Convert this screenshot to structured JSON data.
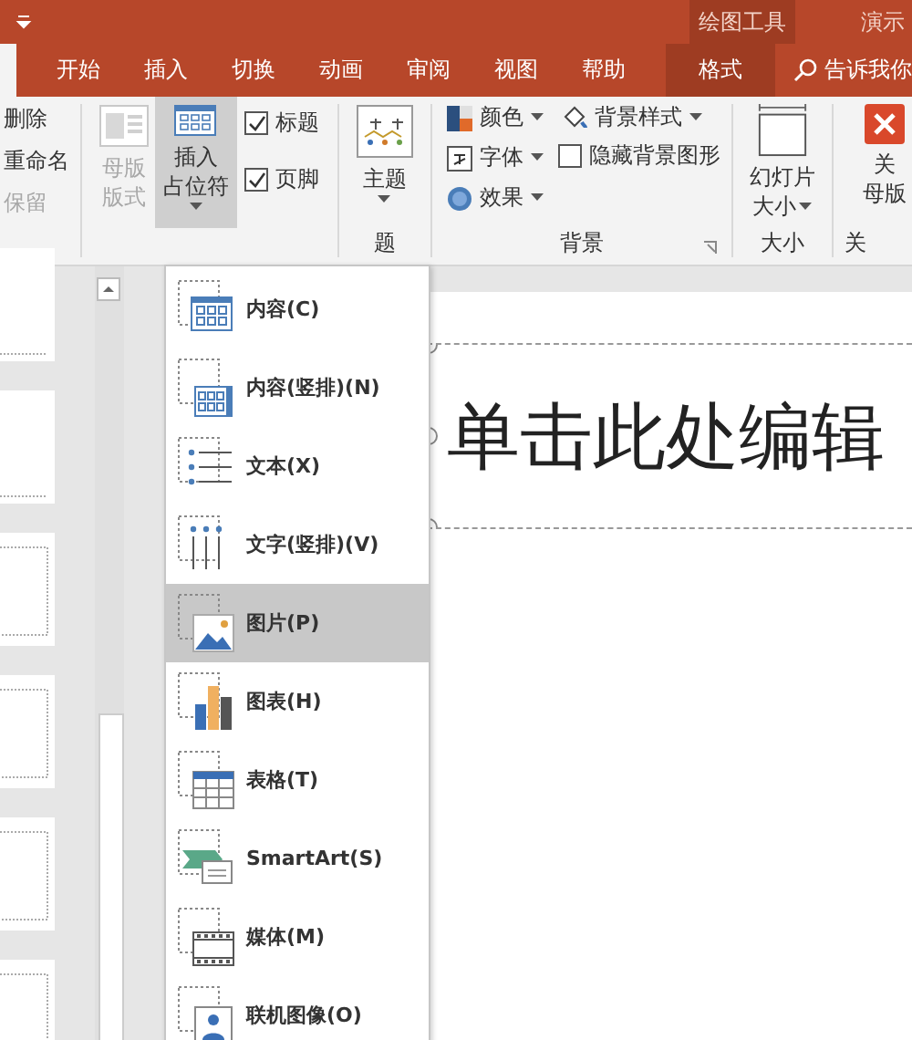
{
  "title_bar": {
    "tool_group": "绘图工具",
    "document_title": "演示"
  },
  "tabs": [
    {
      "label": "开始",
      "contextual": false
    },
    {
      "label": "插入",
      "contextual": false
    },
    {
      "label": "切换",
      "contextual": false
    },
    {
      "label": "动画",
      "contextual": false
    },
    {
      "label": "审阅",
      "contextual": false
    },
    {
      "label": "视图",
      "contextual": false
    },
    {
      "label": "帮助",
      "contextual": false
    },
    {
      "label": "格式",
      "contextual": true
    }
  ],
  "tell_me": "告诉我你",
  "ribbon": {
    "edit_commands": [
      {
        "label": "删除",
        "disabled": false
      },
      {
        "label": "重命名",
        "disabled": false
      },
      {
        "label": "保留",
        "disabled": true
      }
    ],
    "master_layout": {
      "lines": [
        "母版",
        "版式"
      ],
      "disabled": true
    },
    "insert_placeholder": {
      "lines": [
        "插入",
        "占位符"
      ],
      "expanded": true
    },
    "checkboxes": [
      {
        "label": "标题",
        "checked": true
      },
      {
        "label": "页脚",
        "checked": true
      }
    ],
    "theme": {
      "label": "主题",
      "group": "题"
    },
    "background_left": [
      {
        "label": "颜色"
      },
      {
        "label": "字体"
      },
      {
        "label": "效果"
      }
    ],
    "background_style": "背景样式",
    "hide_background": {
      "label": "隐藏背景图形",
      "checked": false
    },
    "background_group": "背景",
    "slide_size": {
      "lines": [
        "幻灯片",
        "大小"
      ],
      "group": "大小"
    },
    "close": {
      "lines": [
        "关",
        "母版"
      ],
      "group": "关"
    }
  },
  "slide": {
    "title_placeholder": "单击此处编辑"
  },
  "menu": [
    {
      "kind": "content",
      "label": "内容(C)",
      "selected": false
    },
    {
      "kind": "content-vertical",
      "label": "内容(竖排)(N)",
      "selected": false
    },
    {
      "kind": "text",
      "label": "文本(X)",
      "selected": false
    },
    {
      "kind": "text-vertical",
      "label": "文字(竖排)(V)",
      "selected": false
    },
    {
      "kind": "picture",
      "label": "图片(P)",
      "selected": true
    },
    {
      "kind": "chart",
      "label": "图表(H)",
      "selected": false
    },
    {
      "kind": "table",
      "label": "表格(T)",
      "selected": false
    },
    {
      "kind": "smartart",
      "label": "SmartArt(S)",
      "selected": false
    },
    {
      "kind": "media",
      "label": "媒体(M)",
      "selected": false
    },
    {
      "kind": "online-picture",
      "label": "联机图像(O)",
      "selected": false
    }
  ]
}
